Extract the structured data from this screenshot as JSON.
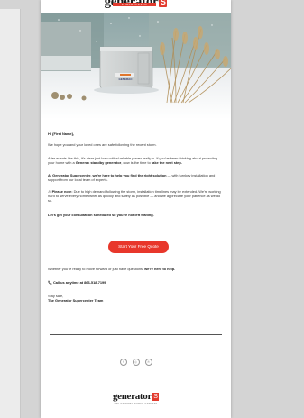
{
  "brand": {
    "logo_word": "generator",
    "logo_badge": "S",
    "logo_sub": "SUPERCENTER",
    "footer_tagline": "THE STANDBY POWER EXPERTS"
  },
  "hero": {
    "generator_label": "GENERAC"
  },
  "email": {
    "greeting": "Hi {First Name},",
    "p1": "We hope you and your loved ones are safe following the recent storm.",
    "p2_a": "After events like this, it's clear just how critical reliable power really is. If you've been thinking about protecting your home with a ",
    "p2_b": "Generac standby generator",
    "p2_c": ", now is the time to ",
    "p2_d": "take the next step.",
    "p3_a": "At Generator Supercenter, we're here to help you find the right solution",
    "p3_b": " — with turnkey installation and support from our local team of experts.",
    "p4_icon": "⚠",
    "p4_a": "Please note:",
    "p4_b": " Due to high demand following the storm, installation timelines may be extended. We're working hard to serve every homeowner as quickly and safely as possible — and we appreciate your patience as we do so.",
    "p5": "Let's get your consultation scheduled so you're not left waiting.",
    "cta_label": "Start Your Free Quote",
    "p6_a": "Whether you're ready to move forward or just have questions, ",
    "p6_b": "we're here to help.",
    "phone_icon": "📞",
    "phone": "Call us anytime at 866-518-7199",
    "signoff": "Stay safe,",
    "signature": "The Generator Supercenter Team"
  },
  "social": {
    "icons": [
      "facebook-icon",
      "instagram-icon",
      "pinterest-icon"
    ],
    "glyphs": [
      "f",
      "◎",
      "℗"
    ]
  }
}
